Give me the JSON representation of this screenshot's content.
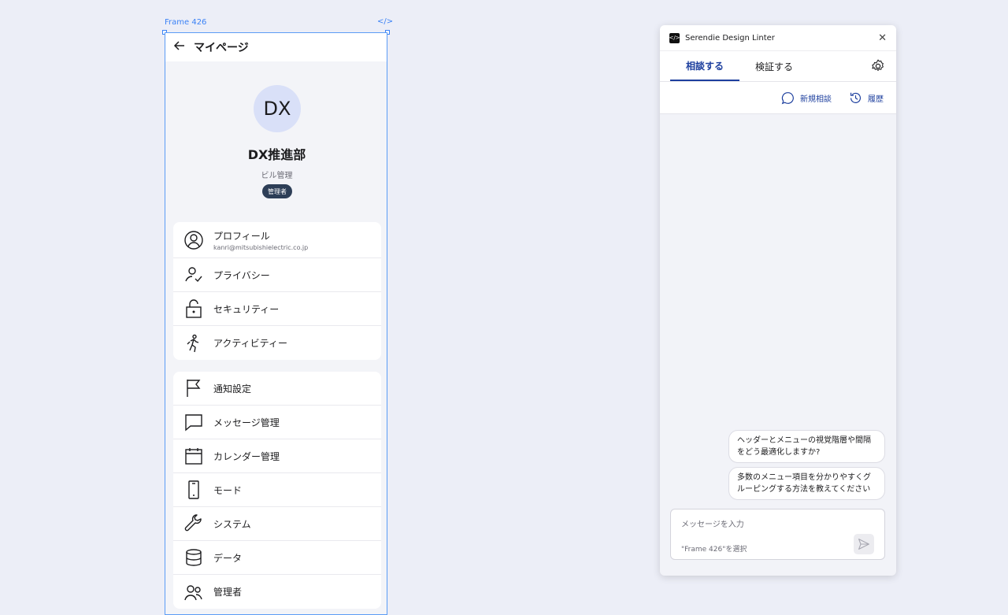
{
  "frame": {
    "label": "Frame 426",
    "code_tag": "</>",
    "header_title": "マイページ",
    "avatar_initials": "DX",
    "org_name": "DX推進部",
    "org_subtitle": "ビル管理",
    "role_badge": "管理者",
    "menu_group_1": [
      {
        "label": "プロフィール",
        "sub": "kanri@mitsubishielectric.co.jp",
        "icon": "user-circle-icon"
      },
      {
        "label": "プライバシー",
        "icon": "person-check-icon"
      },
      {
        "label": "セキュリティー",
        "icon": "lock-open-icon"
      },
      {
        "label": "アクティビティー",
        "icon": "running-icon"
      }
    ],
    "menu_group_2": [
      {
        "label": "通知設定",
        "icon": "flag-icon"
      },
      {
        "label": "メッセージ管理",
        "icon": "chat-icon"
      },
      {
        "label": "カレンダー管理",
        "icon": "calendar-icon"
      },
      {
        "label": "モード",
        "icon": "phone-icon"
      },
      {
        "label": "システム",
        "icon": "wrench-icon"
      },
      {
        "label": "データ",
        "icon": "database-icon"
      },
      {
        "label": "管理者",
        "icon": "users-icon"
      }
    ]
  },
  "plugin": {
    "logo": "</>",
    "name": "Serendie Design Linter",
    "close": "✕",
    "tabs": [
      "相談する",
      "検証する"
    ],
    "active_tab": "相談する",
    "actions": {
      "new_consult": "新規相談",
      "history": "履歴"
    },
    "suggestions": [
      "ヘッダーとメニューの視覚階層や間隔をどう最適化しますか?",
      "多数のメニュー項目を分かりやすくグルーピングする方法を教えてください"
    ],
    "input_placeholder": "メッセージを入力",
    "input_context": "\"Frame 426\"を選択"
  },
  "colors": {
    "canvas_bg": "#eceef7",
    "accent": "#1d3f9e",
    "selection": "#3b82f6",
    "badge_bg": "#2d3e57",
    "avatar_bg": "#d9e0f8"
  }
}
